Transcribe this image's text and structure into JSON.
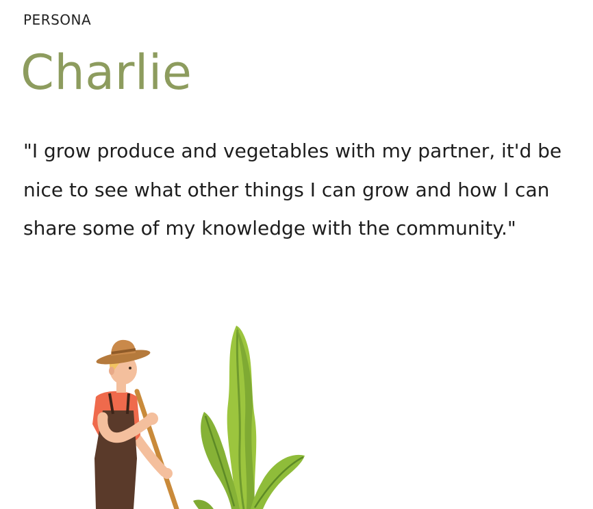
{
  "persona": {
    "label": "PERSONA",
    "name": "Charlie",
    "quote": "\"I grow produce and vegetables with my partner, it'd be nice to see what other things I can grow and how I can share some of my knowledge with the community.\""
  },
  "colors": {
    "name_accent": "#8d9c5e",
    "body_text": "#1d1d1d",
    "shirt": "#ef6a4c",
    "overalls": "#5a3a2a",
    "hat": "#b57a3c",
    "hair": "#f2c462",
    "skin": "#f4bf9d",
    "leaf_dark": "#6f9a2e",
    "leaf_light": "#9cc53e",
    "stick": "#c98a3a"
  },
  "icons": {
    "illustration": "gardener-with-plant-illustration"
  }
}
